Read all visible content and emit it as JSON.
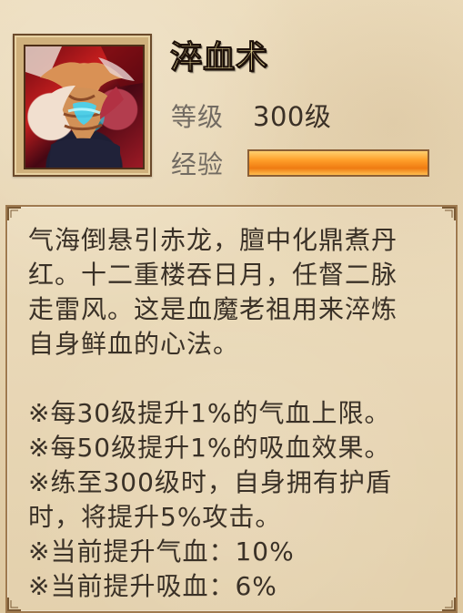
{
  "skill": {
    "title": "淬血术",
    "level_label": "等级",
    "level_value": "300级",
    "exp_label": "经验",
    "exp_progress_percent": 100
  },
  "description": {
    "lines": [
      "气海倒悬引赤龙，膻中化鼎煮丹",
      "红。十二重楼吞日月，任督二脉",
      "走雷风。这是血魔老祖用来淬炼",
      "自身鲜血的心法。"
    ],
    "effects": [
      "※每30级提升1%的气血上限。",
      "※每50级提升1%的吸血效果。",
      "※练至300级时，自身拥有护盾",
      "时，将提升5%攻击。",
      "※当前提升气血：10%",
      "※当前提升吸血：6%"
    ]
  },
  "colors": {
    "background": "#e7d7b6",
    "title": "#f3e39e",
    "label": "#726b62",
    "text": "#3a3127",
    "exp_fill": "#ef7b12",
    "border": "#9f7a4f"
  },
  "icons": {
    "portrait": "skill-portrait-icon",
    "corner": "corner-ornament-icon"
  }
}
